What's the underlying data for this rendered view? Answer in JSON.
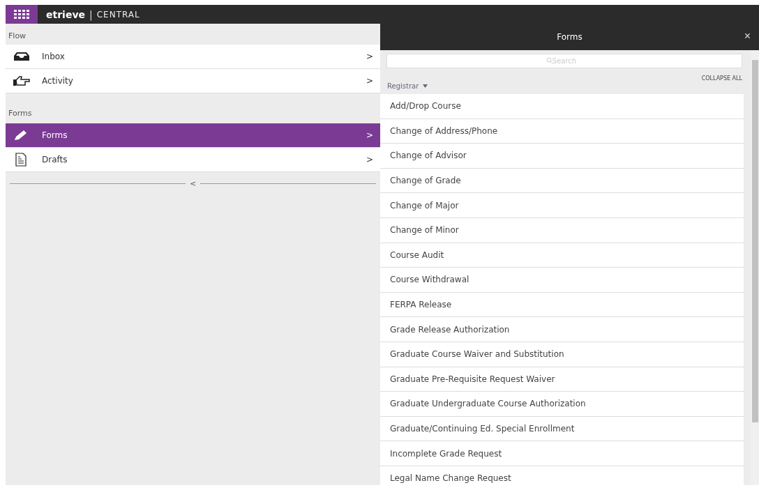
{
  "brand": {
    "name": "etrieve",
    "divider": "|",
    "product": "CENTRAL"
  },
  "sidebar": {
    "sections": [
      {
        "title": "Flow",
        "items": [
          {
            "label": "Inbox",
            "kind": "inbox",
            "selected": false,
            "chevron": ">"
          },
          {
            "label": "Activity",
            "kind": "activity",
            "selected": false,
            "chevron": ">"
          }
        ]
      },
      {
        "title": "Forms",
        "items": [
          {
            "label": "Forms",
            "kind": "forms",
            "selected": true,
            "chevron": ">"
          },
          {
            "label": "Drafts",
            "kind": "drafts",
            "selected": false,
            "chevron": ">"
          }
        ]
      }
    ],
    "collapse": "<"
  },
  "forms_panel": {
    "title": "Forms",
    "close": "×",
    "search": {
      "placeholder": "Search"
    },
    "group": "Registrar",
    "collapse_all": "COLLAPSE ALL",
    "items": [
      "Add/Drop Course",
      "Change of Address/Phone",
      "Change of Advisor",
      "Change of Grade",
      "Change of Major",
      "Change of Minor",
      "Course Audit",
      "Course Withdrawal",
      "FERPA Release",
      "Grade Release Authorization",
      "Graduate Course Waiver and Substitution",
      "Graduate Pre-Requisite Request Waiver",
      "Graduate Undergraduate Course Authorization",
      "Graduate/Continuing Ed. Special Enrollment",
      "Incomplete Grade Request",
      "Legal Name Change Request"
    ]
  }
}
